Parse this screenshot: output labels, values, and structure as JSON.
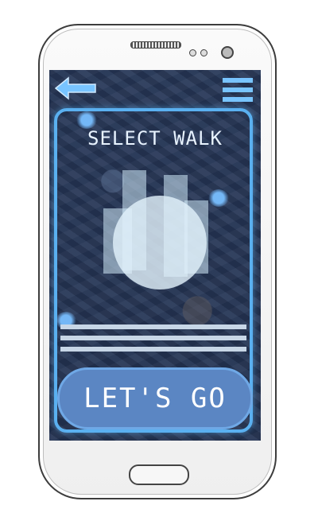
{
  "screen": {
    "title": "SELECT WALK",
    "go_button_label": "LET'S GO"
  },
  "icons": {
    "back": "back-arrow-icon",
    "menu": "hamburger-menu-icon"
  },
  "colors": {
    "accent": "#5ab0f0",
    "button": "#5b86c3",
    "title_text": "#e8f3ff"
  }
}
